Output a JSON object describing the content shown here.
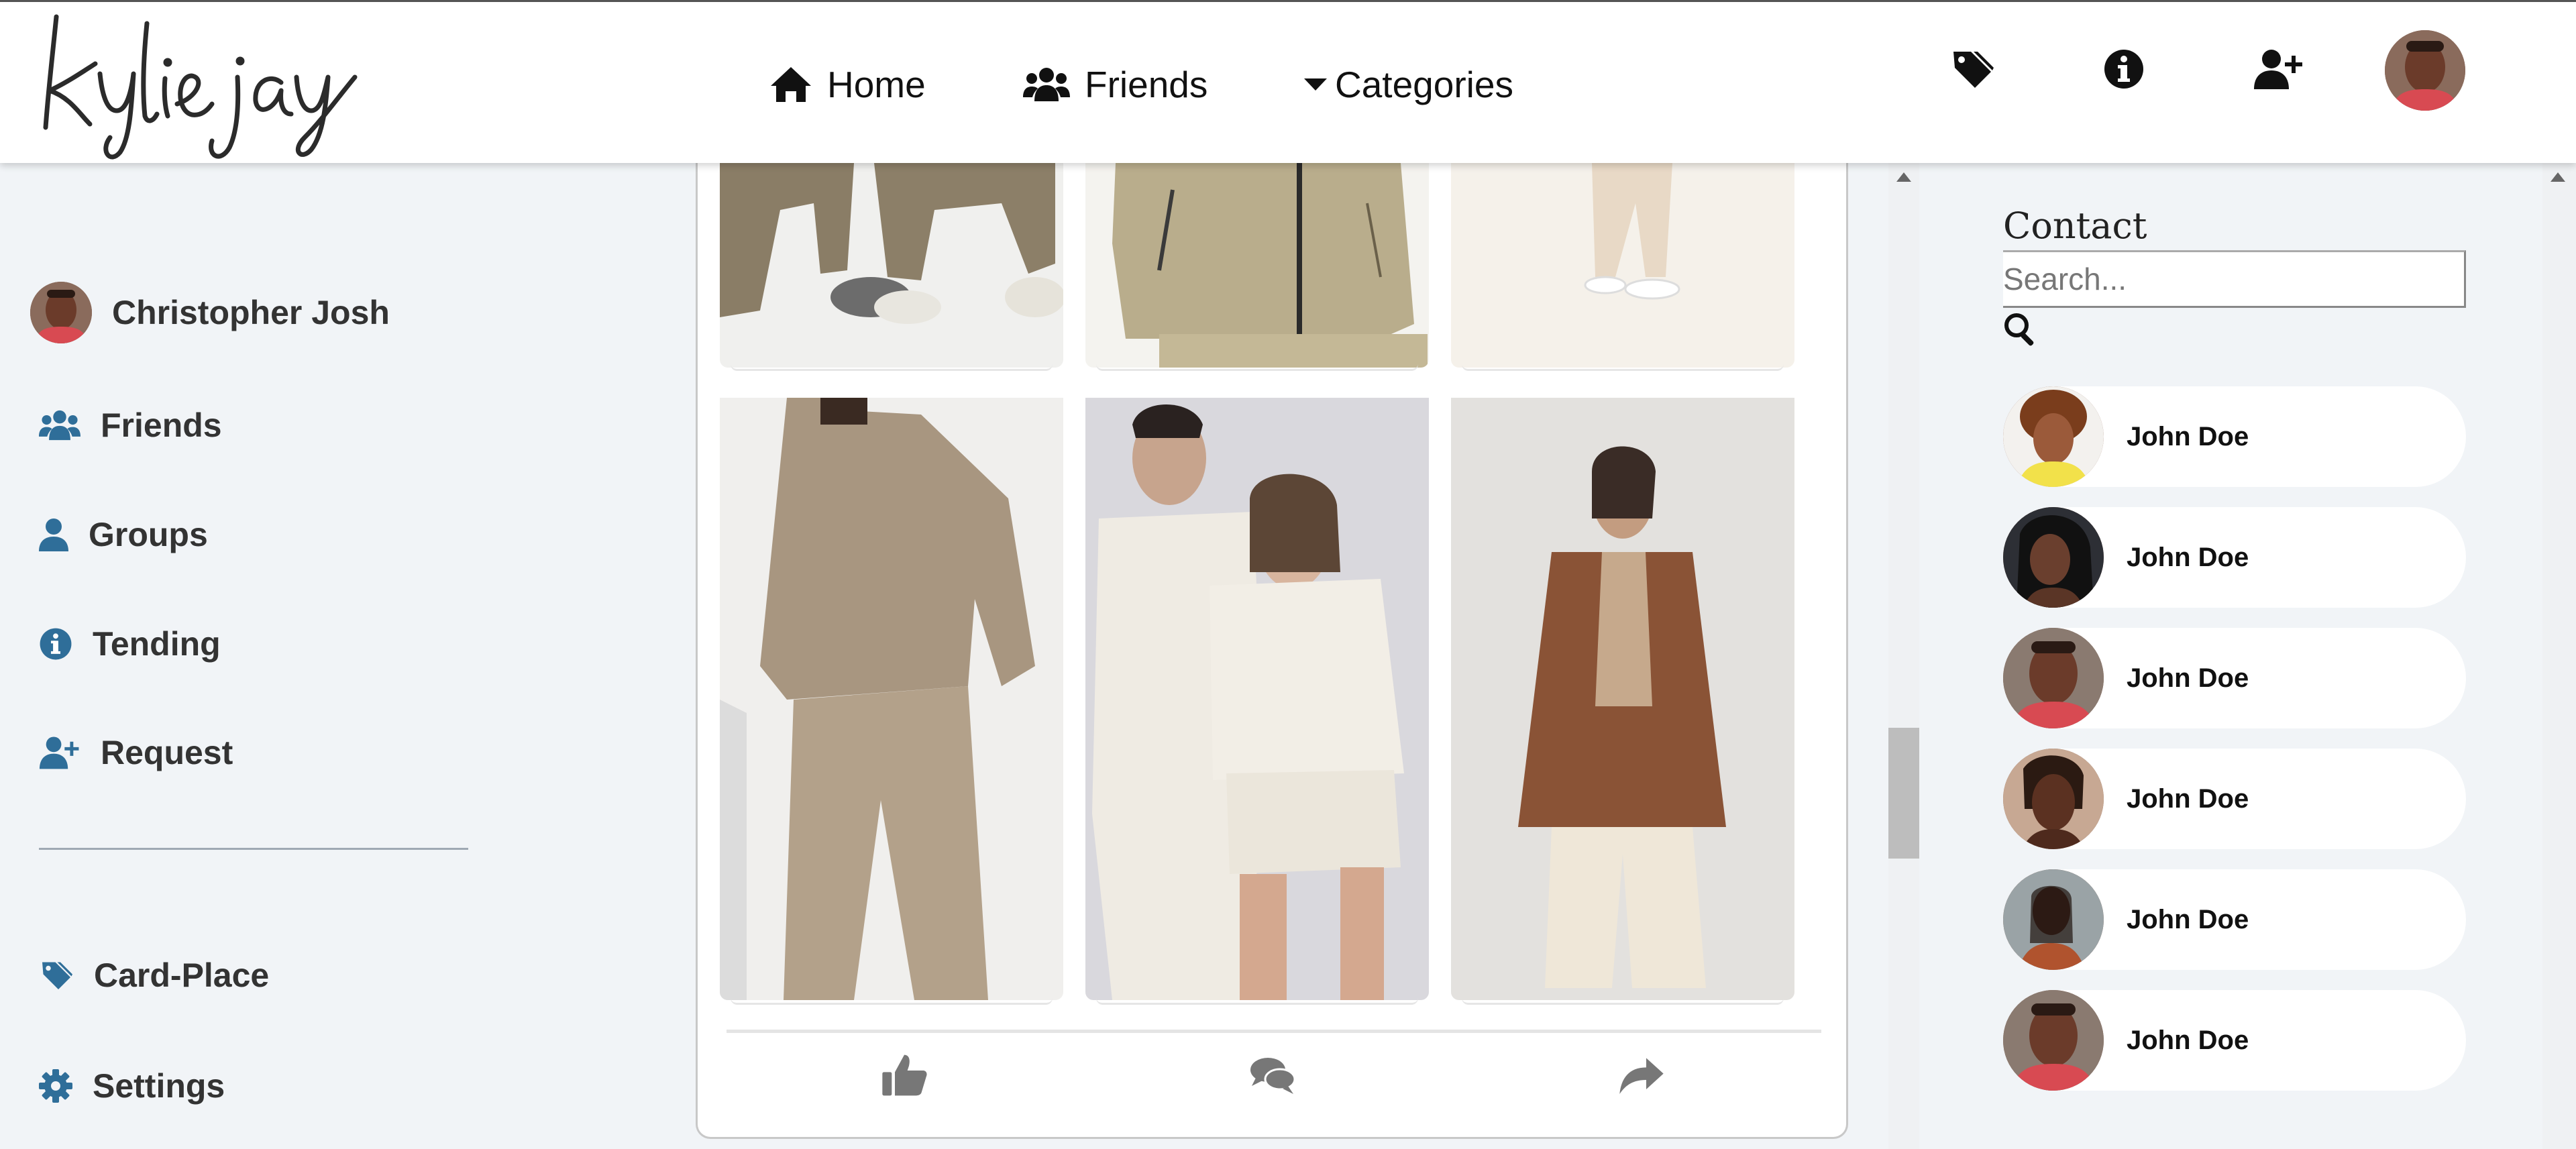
{
  "brand": {
    "logo_text": "kylie jay"
  },
  "nav": {
    "home": "Home",
    "friends": "Friends",
    "categories": "Categories"
  },
  "header_icons": [
    "tag-icon",
    "info-icon",
    "add-user-icon",
    "user-avatar"
  ],
  "sidebar": {
    "profile_name": "Christopher Josh",
    "items": [
      {
        "label": "Friends",
        "icon": "users-icon"
      },
      {
        "label": "Groups",
        "icon": "user-icon"
      },
      {
        "label": "Tending",
        "icon": "info-icon"
      },
      {
        "label": "Request",
        "icon": "add-user-icon"
      },
      {
        "label": "Card-Place",
        "icon": "tags-icon"
      },
      {
        "label": "Settings",
        "icon": "gear-icon"
      }
    ]
  },
  "feed": {
    "actions": [
      "like-icon",
      "comment-icon",
      "share-icon"
    ]
  },
  "contacts": {
    "title": "Contact",
    "search_placeholder": "Search...",
    "items": [
      {
        "name": "John Doe"
      },
      {
        "name": "John Doe"
      },
      {
        "name": "John Doe"
      },
      {
        "name": "John Doe"
      },
      {
        "name": "John Doe"
      },
      {
        "name": "John Doe"
      }
    ]
  },
  "colors": {
    "accent": "#2f6e99",
    "background": "#f1f4f7",
    "header": "#ffffff"
  }
}
